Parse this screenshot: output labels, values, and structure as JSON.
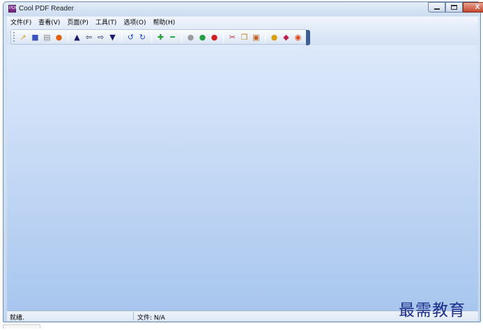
{
  "window": {
    "title": "Cool PDF Reader",
    "app_icon_text": "PDF",
    "close_glyph": "X"
  },
  "menubar": {
    "items": [
      "文件(F)",
      "查看(V)",
      "页面(P)",
      "工具(T)",
      "选项(O)",
      "帮助(H)"
    ]
  },
  "toolbar": {
    "groups": [
      [
        {
          "name": "open-icon",
          "glyph": "➚",
          "color": "#e0a020"
        },
        {
          "name": "save-icon",
          "glyph": "■",
          "color": "#3b55c0"
        },
        {
          "name": "print-icon",
          "glyph": "▤",
          "color": "#8a8a8a"
        },
        {
          "name": "info-icon",
          "glyph": "●",
          "color": "#e06010"
        }
      ],
      [
        {
          "name": "first-page-icon",
          "glyph": "▲",
          "color": "#1a1a6a"
        },
        {
          "name": "prev-page-icon",
          "glyph": "⇦",
          "color": "#1a1a6a"
        },
        {
          "name": "next-page-icon",
          "glyph": "⇨",
          "color": "#1a1a6a"
        },
        {
          "name": "last-page-icon",
          "glyph": "▼",
          "color": "#1a1a6a"
        }
      ],
      [
        {
          "name": "rotate-left-icon",
          "glyph": "↺",
          "color": "#2a48c8"
        },
        {
          "name": "rotate-right-icon",
          "glyph": "↻",
          "color": "#2a48c8"
        }
      ],
      [
        {
          "name": "zoom-in-icon",
          "glyph": "✚",
          "color": "#20a030"
        },
        {
          "name": "zoom-out-icon",
          "glyph": "━",
          "color": "#20a030"
        }
      ],
      [
        {
          "name": "gray-dot-icon",
          "glyph": "●",
          "color": "#9a9a9a"
        },
        {
          "name": "green-dot-icon",
          "glyph": "●",
          "color": "#20a040"
        },
        {
          "name": "red-dot-icon",
          "glyph": "●",
          "color": "#d02020"
        }
      ],
      [
        {
          "name": "cut-icon",
          "glyph": "✂",
          "color": "#c03030"
        },
        {
          "name": "copy-icon",
          "glyph": "❐",
          "color": "#c08020"
        },
        {
          "name": "image-icon",
          "glyph": "▣",
          "color": "#c06020"
        }
      ],
      [
        {
          "name": "globe-icon",
          "glyph": "●",
          "color": "#d8a010"
        },
        {
          "name": "book-icon",
          "glyph": "◆",
          "color": "#c02050"
        },
        {
          "name": "stop-icon",
          "glyph": "◉",
          "color": "#e04010"
        }
      ]
    ]
  },
  "statusbar": {
    "status_text": "就绪.",
    "file_text": "文件: N/A"
  },
  "watermark": {
    "text": "最需教育"
  }
}
